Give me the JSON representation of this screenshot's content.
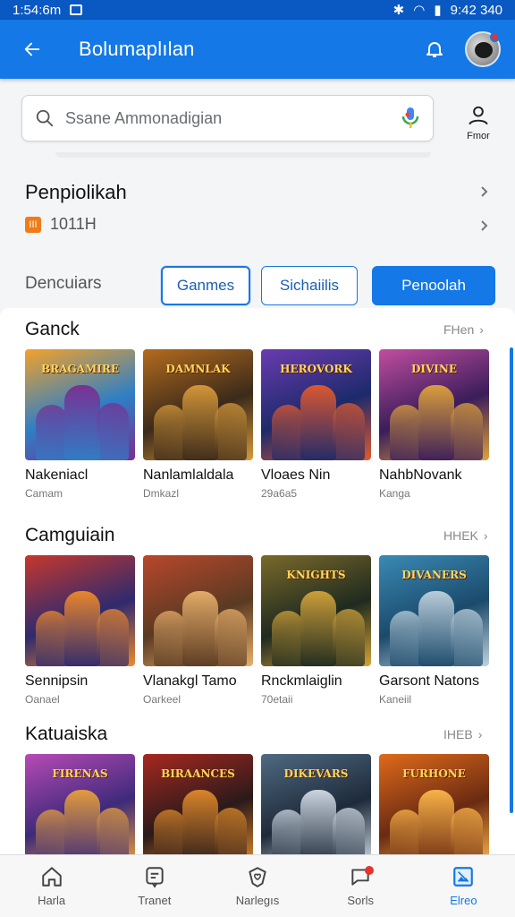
{
  "status_bar": {
    "time_left": "1:54:6m",
    "time_right": "9:42 340"
  },
  "app_bar": {
    "title": "Bolumaplılan",
    "back_icon": "arrow-left-icon",
    "bell_icon": "bell-icon"
  },
  "search": {
    "placeholder": "Ssane Ammonadigian",
    "profile_label": "Fmor"
  },
  "section": {
    "heading": "Penpiolikah",
    "subline": "1011H",
    "badge": "III"
  },
  "filters": {
    "label": "Dencuiars",
    "chips": [
      "Ganmes",
      "Sichaiilis",
      "Penoolah"
    ]
  },
  "groups": [
    {
      "title": "Ganck",
      "more": "FHen",
      "items": [
        {
          "name": "Nakeniacl",
          "sub": "Camam",
          "logo": "BRAGAMIRE",
          "colors": [
            "#2e7fc6",
            "#f3a22a",
            "#7a2d91"
          ]
        },
        {
          "name": "Nanlamlaldala",
          "sub": "Dmkazl",
          "logo": "DAMNLAK",
          "colors": [
            "#3b2a1a",
            "#b46b1e",
            "#d89a3a"
          ]
        },
        {
          "name": "Vloaes Nin",
          "sub": "29a6a5",
          "logo": "HEROVORK",
          "colors": [
            "#1d2a6b",
            "#6a3bb0",
            "#e25a2d"
          ]
        },
        {
          "name": "NahbNovank",
          "sub": "Kanga",
          "logo": "DIVINE",
          "colors": [
            "#3a1d5a",
            "#c24da0",
            "#e0a43a"
          ]
        }
      ]
    },
    {
      "title": "Camguiain",
      "more": "HHEK",
      "items": [
        {
          "name": "Sennipsin",
          "sub": "Oanael",
          "logo": "",
          "colors": [
            "#2f2a6e",
            "#c6382c",
            "#ef8a2a"
          ]
        },
        {
          "name": "Vlanakgl Tamo",
          "sub": "Oarkeel",
          "logo": "",
          "colors": [
            "#5a3a22",
            "#b9472c",
            "#e8b06b"
          ]
        },
        {
          "name": "Rnckmlaiglin",
          "sub": "70etaii",
          "logo": "KNIGHTS",
          "colors": [
            "#1f2a1f",
            "#7a6a2a",
            "#d3a43a"
          ]
        },
        {
          "name": "Garsont Natons",
          "sub": "Kaneiil",
          "logo": "DIVANERS",
          "colors": [
            "#1b4a6b",
            "#3a8ab5",
            "#c0d2de"
          ]
        }
      ]
    },
    {
      "title": "Katuaiska",
      "more": "IHEB",
      "items": [
        {
          "name": "",
          "sub": "",
          "logo": "FIRENAS",
          "colors": [
            "#3d2a7a",
            "#b84ab5",
            "#e8a13a"
          ]
        },
        {
          "name": "",
          "sub": "",
          "logo": "BIRAANCES",
          "colors": [
            "#2a1a1a",
            "#a7281f",
            "#e08a2a"
          ]
        },
        {
          "name": "",
          "sub": "",
          "logo": "DIKEVARS",
          "colors": [
            "#1e2a3a",
            "#4f6a82",
            "#d2dce6"
          ]
        },
        {
          "name": "",
          "sub": "",
          "logo": "FURHONE",
          "colors": [
            "#6a2a12",
            "#e06a1a",
            "#ffb84a"
          ]
        }
      ]
    }
  ],
  "bottom_nav": [
    {
      "label": "Harla",
      "icon": "home-icon"
    },
    {
      "label": "Tranet",
      "icon": "message-square-icon"
    },
    {
      "label": "Narlegıs",
      "icon": "shield-heart-icon"
    },
    {
      "label": "Sorls",
      "icon": "chat-bubble-icon"
    },
    {
      "label": "Elreo",
      "icon": "image-icon"
    }
  ]
}
